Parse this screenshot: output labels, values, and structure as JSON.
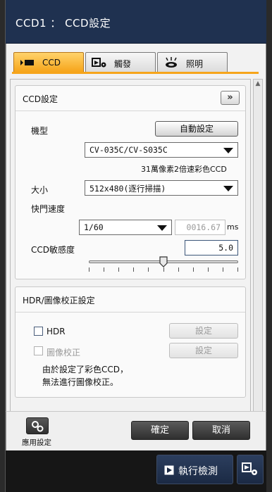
{
  "window": {
    "title": "CCD1 ： CCD設定"
  },
  "tabs": [
    {
      "label": "CCD",
      "icon": "camera-icon",
      "active": true
    },
    {
      "label": "觸發",
      "icon": "trigger-settings-icon",
      "active": false
    },
    {
      "label": "照明",
      "icon": "lighting-icon",
      "active": false
    }
  ],
  "ccd_group": {
    "title": "CCD設定",
    "expand_label": "»",
    "model_label": "機型",
    "auto_button": "自動設定",
    "model_value": "CV-035C/CV-S035C",
    "model_note": "31萬像素2倍速彩色CCD",
    "size_label": "大小",
    "size_value": "512x480(逐行掃描)",
    "shutter_label": "快門速度",
    "shutter_value": "1/60",
    "shutter_ms": "0016.67",
    "shutter_unit": "ms",
    "sensitivity_label": "CCD敏感度",
    "sensitivity_value": "5.0",
    "sensitivity_fraction": 0.5
  },
  "hdr_group": {
    "title": "HDR/圖像校正設定",
    "hdr_label": "HDR",
    "hdr_checked": false,
    "hdr_setting": "設定",
    "correction_label": "圖像校正",
    "correction_checked": false,
    "correction_setting": "設定",
    "note_line1": "由於設定了彩色CCD，",
    "note_line2": "無法進行圖像校正。"
  },
  "bottom": {
    "apply_label": "應用設定",
    "ok_label": "確定",
    "cancel_label": "取消"
  },
  "footer": {
    "run_label": "執行檢測"
  },
  "colors": {
    "title_bar": "#1f3150",
    "tab_active": "#f6a51b",
    "footer_button": "#1b2a44"
  }
}
